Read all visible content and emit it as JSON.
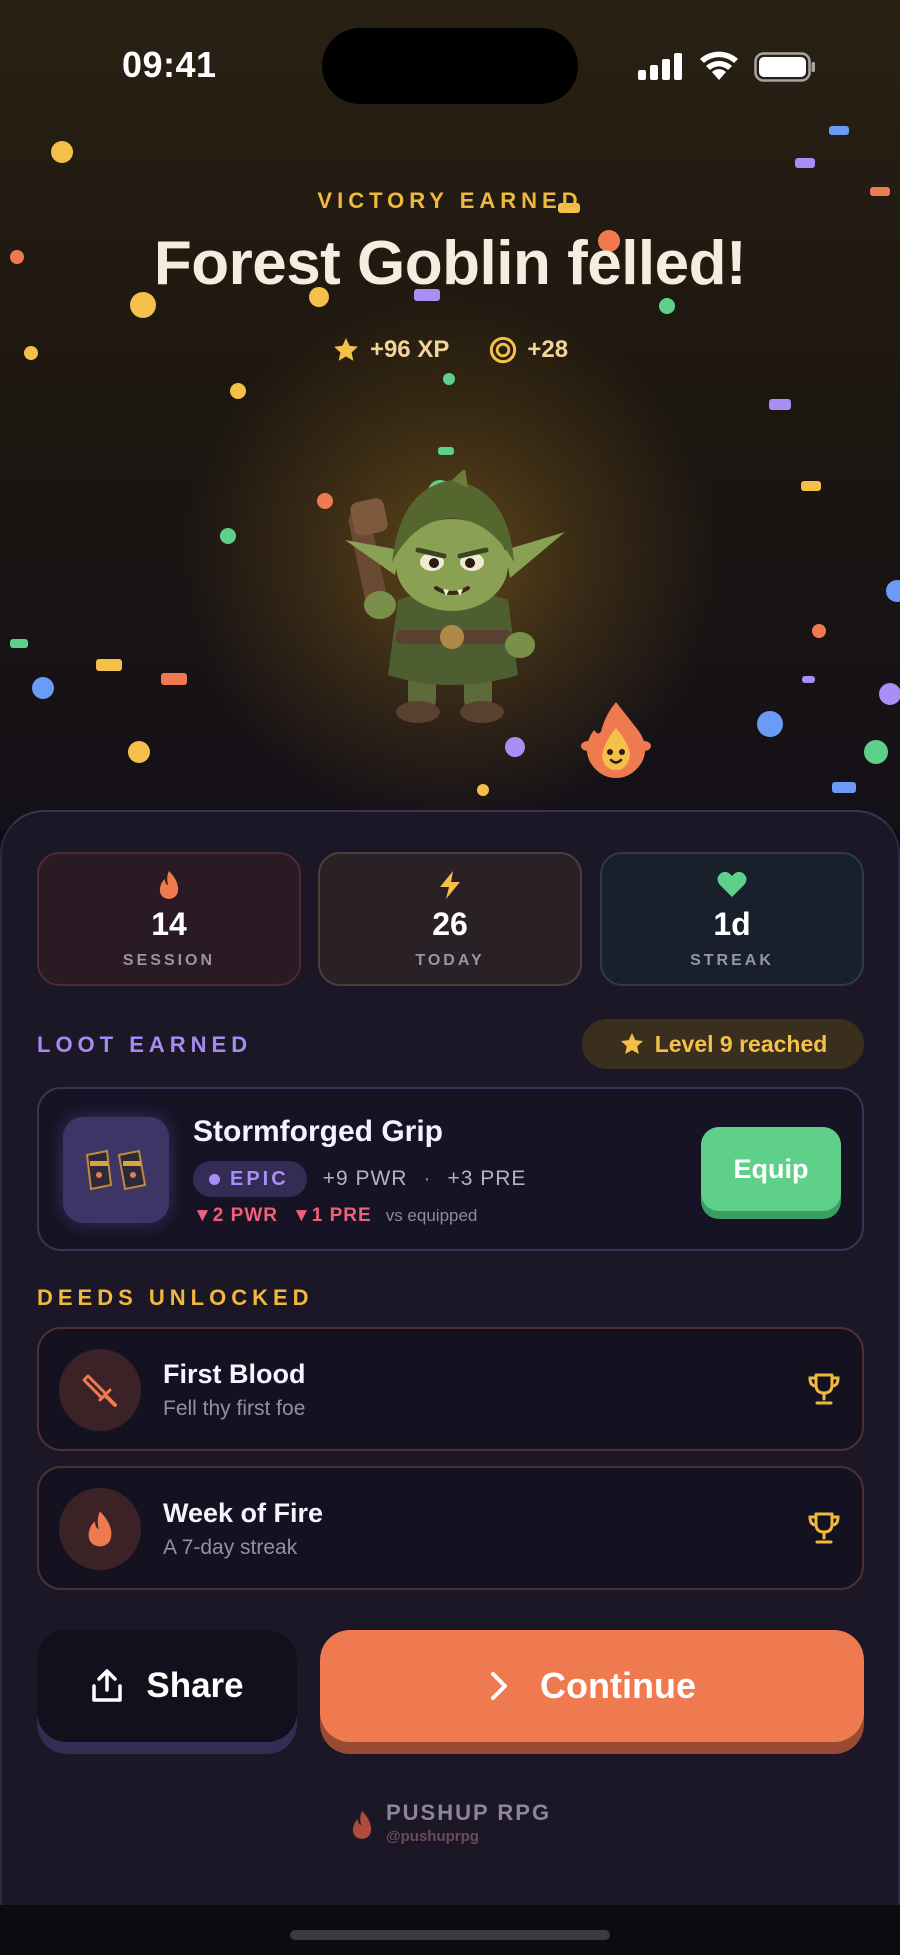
{
  "status_bar": {
    "time": "09:41"
  },
  "hero": {
    "kicker": "VICTORY EARNED",
    "title": "Forest Goblin felled!",
    "xp": "+96 XP",
    "coins": "+28",
    "enemy_icon": "forest-goblin-illustration",
    "mascot_icon": "flame-mascot"
  },
  "stats": [
    {
      "value": "14",
      "label": "SESSION",
      "icon": "flame-icon",
      "color": "#f07a50"
    },
    {
      "value": "26",
      "label": "TODAY",
      "icon": "lightning-icon",
      "color": "#f5c04a"
    },
    {
      "value": "1d",
      "label": "STREAK",
      "icon": "heart-icon",
      "color": "#5fd08a"
    }
  ],
  "loot": {
    "section_label": "LOOT EARNED",
    "level_badge": "Level 9 reached",
    "item_name": "Stormforged Grip",
    "rarity": "EPIC",
    "bonus_pwr": "+9 PWR",
    "separator": "·",
    "bonus_pre": "+3 PRE",
    "delta_pwr": "▼2 PWR",
    "delta_pre": "▼1 PRE",
    "compare_note": "vs equipped",
    "equip_label": "Equip"
  },
  "deeds": {
    "section_label": "DEEDS UNLOCKED",
    "items": [
      {
        "title": "First Blood",
        "subtitle": "Fell thy first foe",
        "icon": "sword-icon"
      },
      {
        "title": "Week of Fire",
        "subtitle": "A 7-day streak",
        "icon": "flame-icon"
      }
    ]
  },
  "actions": {
    "share_label": "Share",
    "continue_label": "Continue"
  },
  "brand": {
    "name": "PUSHUP RPG",
    "handle": "@pushuprpg"
  },
  "colors": {
    "accent_orange": "#f07a50",
    "gold": "#f0b93e",
    "epic_purple": "#a88ef5",
    "equip_green": "#5fd08a",
    "sheet_bg": "#1b1727"
  }
}
